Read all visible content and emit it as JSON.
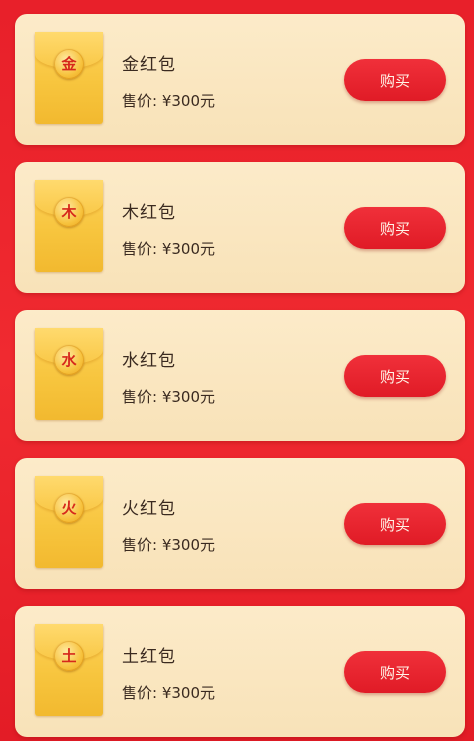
{
  "colors": {
    "background": "#e8202a",
    "card": "#fcebc9",
    "envelope": "#f7c53e",
    "button": "#e61f2a",
    "seal_text": "#d6281b"
  },
  "products": [
    {
      "seal": "金",
      "name": "金红包",
      "price": "售价: ¥300元",
      "buy_label": "购买"
    },
    {
      "seal": "木",
      "name": "木红包",
      "price": "售价: ¥300元",
      "buy_label": "购买"
    },
    {
      "seal": "水",
      "name": "水红包",
      "price": "售价: ¥300元",
      "buy_label": "购买"
    },
    {
      "seal": "火",
      "name": "火红包",
      "price": "售价: ¥300元",
      "buy_label": "购买"
    },
    {
      "seal": "土",
      "name": "土红包",
      "price": "售价: ¥300元",
      "buy_label": "购买"
    }
  ]
}
